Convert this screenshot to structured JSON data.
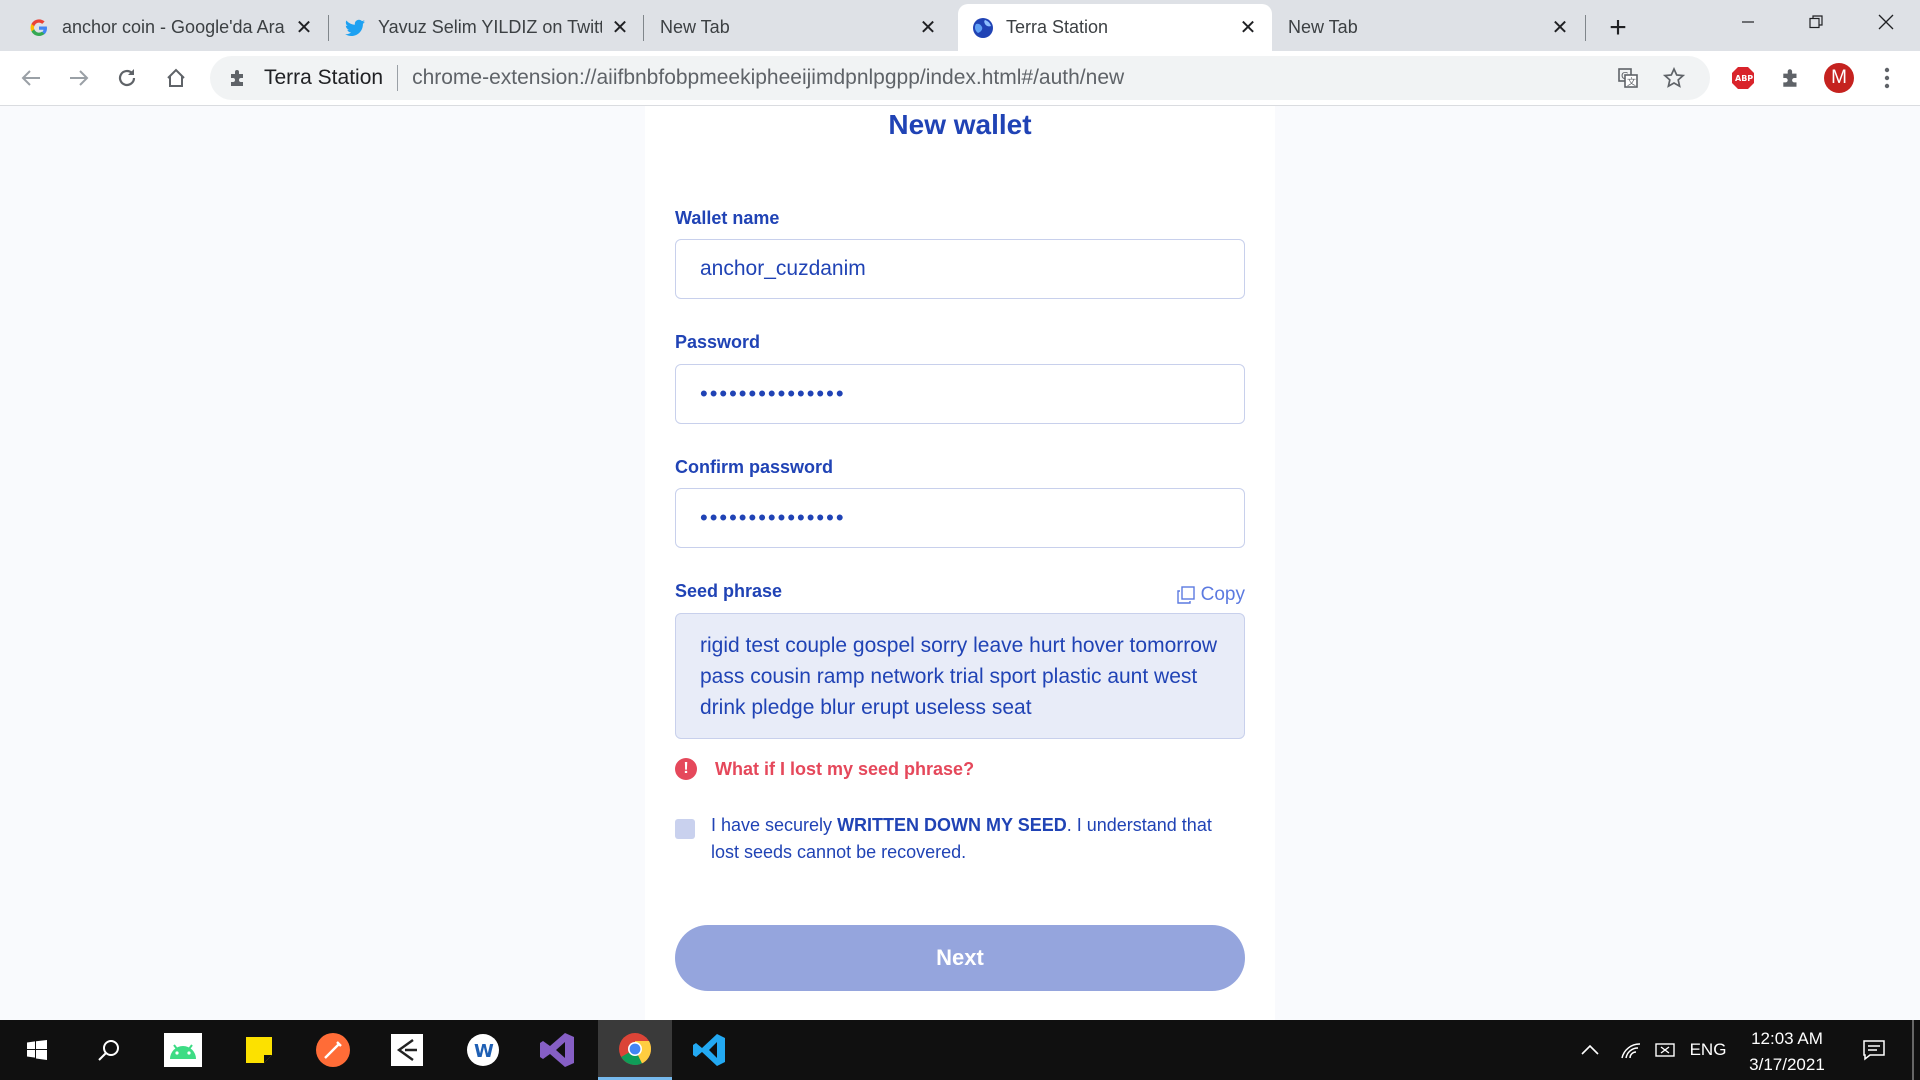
{
  "browser": {
    "tabs": [
      {
        "title": "anchor coin - Google'da Ara",
        "icon": "google-icon",
        "active": false
      },
      {
        "title": "Yavuz Selim YILDIZ on Twitter",
        "icon": "twitter-icon",
        "active": false
      },
      {
        "title": "New Tab",
        "icon": "",
        "active": false
      },
      {
        "title": "Terra Station",
        "icon": "terra-icon",
        "active": true
      },
      {
        "title": "New Tab",
        "icon": "",
        "active": false
      }
    ],
    "new_tab_label": "+",
    "address": {
      "site_name": "Terra Station",
      "url": "chrome-extension://aiifbnbfobpmeekipheeijimdpnlpgpp/index.html#/auth/new"
    },
    "profile_initial": "M"
  },
  "page": {
    "title": "New wallet",
    "wallet_name": {
      "label": "Wallet name",
      "value": "anchor_cuzdanim"
    },
    "password": {
      "label": "Password",
      "value": "•••••••••••••••"
    },
    "confirm_password": {
      "label": "Confirm password",
      "value": "•••••••••••••••"
    },
    "seed": {
      "label": "Seed phrase",
      "copy_label": "Copy",
      "text": "rigid test couple gospel sorry leave hurt hover tomorrow pass cousin ramp network trial sport plastic aunt west drink pledge blur erupt useless seat"
    },
    "warning": {
      "icon": "!",
      "text": "What if I lost my seed phrase?"
    },
    "agreement": {
      "prefix": "I have securely ",
      "emphasis": "WRITTEN DOWN MY SEED",
      "suffix": ". I understand that lost seeds cannot be recovered.",
      "checked": false
    },
    "next_label": "Next"
  },
  "taskbar": {
    "language": "ENG",
    "time": "12:03 AM",
    "date": "3/17/2021"
  },
  "colors": {
    "accent": "#2043b5",
    "warning": "#e5485b",
    "button_disabled": "#95a5dd"
  }
}
